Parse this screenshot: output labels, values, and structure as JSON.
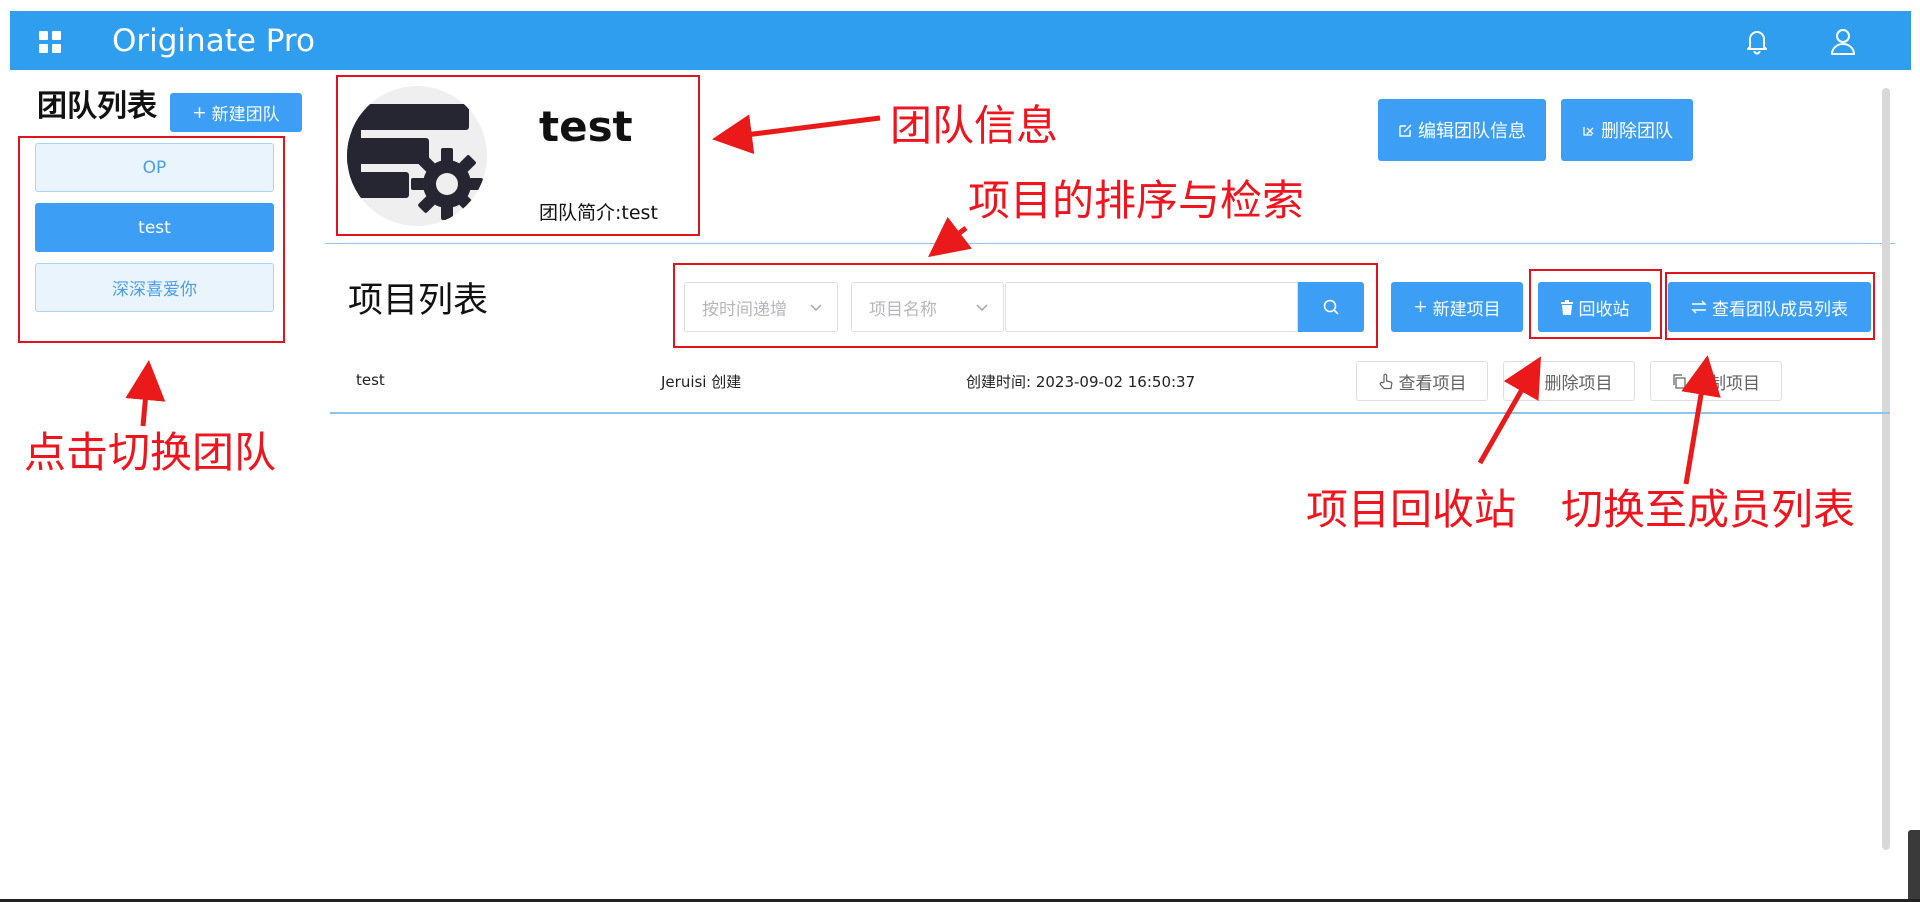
{
  "app": {
    "title": "Originate Pro"
  },
  "sidebar": {
    "title": "团队列表",
    "new_team_label": "新建团队",
    "teams": [
      {
        "name": "OP",
        "active": false
      },
      {
        "name": "test",
        "active": true
      },
      {
        "name": "深深喜爱你",
        "active": false
      }
    ]
  },
  "team": {
    "name": "test",
    "description": "团队简介:test",
    "edit_label": "编辑团队信息",
    "delete_label": "删除团队"
  },
  "projects": {
    "title": "项目列表",
    "sort_placeholder": "按时间递增",
    "field_placeholder": "项目名称",
    "search_value": "",
    "new_label": "新建项目",
    "recycle_label": "回收站",
    "members_label": "查看团队成员列表",
    "rows": [
      {
        "name": "test",
        "creator": "Jeruisi 创建",
        "created": "创建时间:  2023-09-02 16:50:37",
        "view_label": "查看项目",
        "delete_label": "删除项目",
        "copy_label": "复制项目"
      }
    ]
  },
  "annotations": {
    "team_info": "团队信息",
    "sort_search": "项目的排序与检索",
    "switch_team": "点击切换团队",
    "recycle": "项目回收站",
    "members": "切换至成员列表"
  },
  "colors": {
    "topbar": "#2f9eef",
    "primary": "#3d9ef5",
    "annotation": "#e0141e"
  }
}
